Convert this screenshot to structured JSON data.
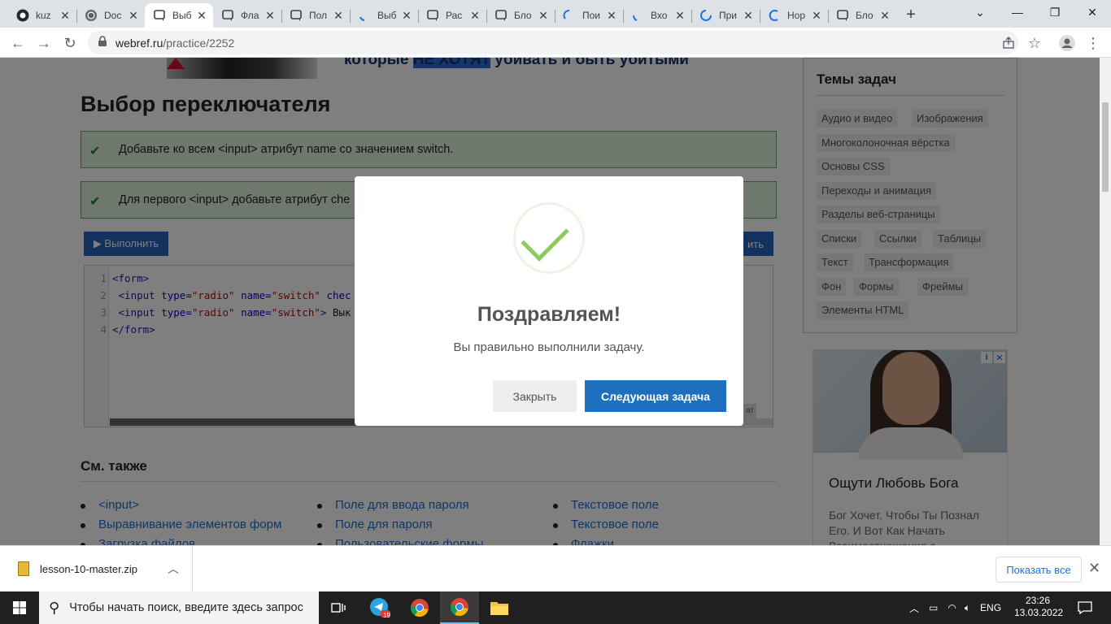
{
  "browser": {
    "tabs": [
      {
        "title": "kuz",
        "icon": "github-icon"
      },
      {
        "title": "Doc",
        "icon": "globe-icon"
      },
      {
        "title": "Выб",
        "icon": "chat-icon",
        "active": true
      },
      {
        "title": "Фла",
        "icon": "chat-icon"
      },
      {
        "title": "Пол",
        "icon": "chat-icon"
      },
      {
        "title": "Выб",
        "icon": "loading-icon"
      },
      {
        "title": "Рас",
        "icon": "chat-icon"
      },
      {
        "title": "Бло",
        "icon": "chat-icon"
      },
      {
        "title": "Пои",
        "icon": "loading-icon"
      },
      {
        "title": "Вхо",
        "icon": "loading-icon"
      },
      {
        "title": "При",
        "icon": "loading-icon"
      },
      {
        "title": "Нор",
        "icon": "loading-icon"
      },
      {
        "title": "Бло",
        "icon": "chat-icon"
      }
    ],
    "url_domain": "webref.ru",
    "url_path": "/practice/2252"
  },
  "page": {
    "banner_text_pre": "которые ",
    "banner_text_hl": "НЕ ХОТЯТ",
    "banner_text_post": " убивать и быть убитыми",
    "title": "Выбор переключателя",
    "tasks": [
      "Добавьте ко всем <input> атрибут name со значением switch.",
      "Для первого <input> добавьте атрибут che"
    ],
    "run_label": "▶ Выполнить",
    "right_button_label": "ить",
    "format_label": "ат",
    "code": {
      "line_numbers": [
        "1",
        "2",
        "3",
        "4"
      ],
      "lines": [
        {
          "tag_open": "<form>"
        },
        {
          "indent": " ",
          "tag": "<input ",
          "a1": "type=",
          "v1": "\"radio\"",
          "a2": " name=",
          "v2": "\"switch\"",
          "a3": " chec"
        },
        {
          "indent": " ",
          "tag": "<input ",
          "a1": "type=",
          "v1": "\"radio\"",
          "a2": " name=",
          "v2": "\"switch\"",
          "end": ">",
          "text": " Вык"
        },
        {
          "tag_open": "</form>"
        }
      ]
    },
    "see_also_title": "См. также",
    "see_also": {
      "col1": [
        "<input>",
        "Выравнивание элементов форм",
        "Загрузка файлов"
      ],
      "col2": [
        "Поле для ввода пароля",
        "Поле для пароля",
        "Пользовательские формы"
      ],
      "col3": [
        "Текстовое поле",
        "Текстовое поле",
        "Флажки"
      ]
    }
  },
  "sidebar": {
    "topics_title": "Темы задач",
    "topics": [
      "Аудио и видео",
      "Изображения",
      "Многоколоночная вёрстка",
      "Основы CSS",
      "Переходы и анимация",
      "Разделы веб-страницы",
      "Списки",
      "Ссылки",
      "Таблицы",
      "Текст",
      "Трансформация",
      "Фон",
      "Формы",
      "Фреймы",
      "Элементы HTML"
    ],
    "ad_title": "Ощути Любовь Бога",
    "ad_text": "Бог Хочет, Чтобы Ты Познал Его. И Вот Как Начать Взаимоотношения с"
  },
  "modal": {
    "title": "Поздравляем!",
    "message": "Вы правильно выполнили задачу.",
    "close_label": "Закрыть",
    "next_label": "Следующая задача"
  },
  "download_bar": {
    "file_name": "lesson-10-master.zip",
    "show_all_label": "Показать все"
  },
  "taskbar": {
    "search_placeholder": "Чтобы начать поиск, введите здесь запрос",
    "telegram_badge": "19",
    "language": "ENG",
    "time": "23:26",
    "date": "13.03.2022"
  },
  "colors": {
    "accent_blue": "#1f6fbf",
    "success_green": "#8ccc5e",
    "task_bg": "#dff0d8"
  }
}
